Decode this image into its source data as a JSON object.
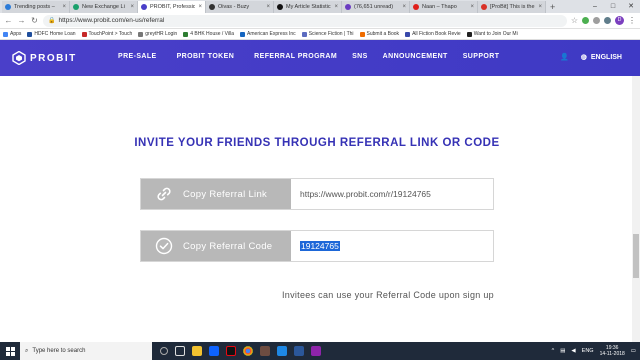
{
  "browser": {
    "tabs": [
      {
        "label": "Trending posts –",
        "color": "#2b7bd8",
        "active": false
      },
      {
        "label": "New Exchange Li",
        "color": "#1aa06b",
        "active": false
      },
      {
        "label": "PROBIT, Professio",
        "color": "#4a3fc9",
        "active": true
      },
      {
        "label": "Oivas - Buzy",
        "color": "#333333",
        "active": false
      },
      {
        "label": "My Article Statistic",
        "color": "#111111",
        "active": false
      },
      {
        "label": "(76,651 unread)",
        "color": "#6a3cc1",
        "active": false
      },
      {
        "label": "Naan – Thapo",
        "color": "#e0201b",
        "active": false
      },
      {
        "label": "[ProBit] This is the",
        "color": "#d93025",
        "active": false
      }
    ],
    "new_tab": "+",
    "url": "https://www.probit.com/en-us/referral",
    "avatar_letter": "D",
    "bookmarks": [
      {
        "label": "Apps",
        "color": "#4285f4"
      },
      {
        "label": "HDFC Home Loan",
        "color": "#1f4e9c"
      },
      {
        "label": "TouchPoint > Touch",
        "color": "#c62828"
      },
      {
        "label": "greytHR Login",
        "color": "#777777"
      },
      {
        "label": "4 BHK House / Villa",
        "color": "#2e7d32"
      },
      {
        "label": "American Express Inc",
        "color": "#1565c0"
      },
      {
        "label": "Science Fiction | Thi",
        "color": "#5c6bc0"
      },
      {
        "label": "Submit a Book",
        "color": "#ef6c00"
      },
      {
        "label": "All Fiction Book Revie",
        "color": "#3949ab"
      },
      {
        "label": "Want to Join Our Mi",
        "color": "#222222"
      }
    ]
  },
  "header": {
    "logo_text": "PROBIT",
    "nav": [
      "PRE-SALE",
      "PROBIT TOKEN",
      "REFERRAL PROGRAM",
      "SNS",
      "ANNOUNCEMENT",
      "SUPPORT"
    ],
    "language": "ENGLISH"
  },
  "main": {
    "title": "INVITE YOUR FRIENDS THROUGH REFERRAL LINK OR CODE",
    "link_button": "Copy Referral Link",
    "link_value": "https://www.probit.com/r/19124765",
    "code_button": "Copy Referral Code",
    "code_value": "19124765",
    "note": "Invitees can use your Referral Code upon sign up"
  },
  "taskbar": {
    "search_placeholder": "Type here to search",
    "language": "ENG",
    "time": "19:36",
    "date": "14-11-2018"
  },
  "colors": {
    "brand": "#4a3fc9",
    "title": "#3632b5",
    "button_gray": "#b8b8b8",
    "selection": "#1d67d8"
  }
}
